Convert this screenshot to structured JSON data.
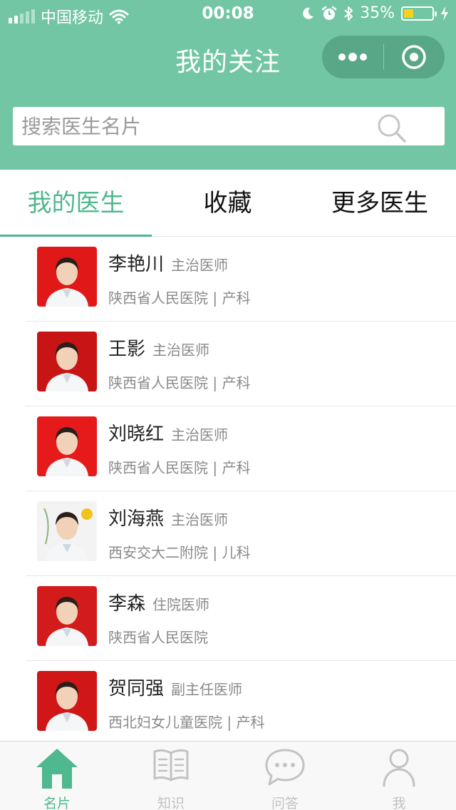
{
  "status_bar": {
    "carrier": "中国移动",
    "time": "00:08",
    "battery": "35%",
    "battery_level": 0.35
  },
  "nav": {
    "title": "我的关注",
    "more_icon": "more-dots-icon",
    "close_icon": "target-circle-icon"
  },
  "search": {
    "placeholder": "搜索医生名片",
    "icon": "search-icon"
  },
  "tabs": [
    {
      "label": "我的医生",
      "active": true
    },
    {
      "label": "收藏",
      "active": false
    },
    {
      "label": "更多医生",
      "active": false
    }
  ],
  "doctors": [
    {
      "name": "李艳川",
      "title": "主治医师",
      "hospital": "陕西省人民医院 | 产科",
      "photo_bg": "#e01818"
    },
    {
      "name": "王影",
      "title": "主治医师",
      "hospital": "陕西省人民医院 | 产科",
      "photo_bg": "#c81414"
    },
    {
      "name": "刘晓红",
      "title": "主治医师",
      "hospital": "陕西省人民医院 | 产科",
      "photo_bg": "#e61a1a"
    },
    {
      "name": "刘海燕",
      "title": "主治医师",
      "hospital": "西安交大二附院 | 儿科",
      "photo_bg": "#f3f3f3"
    },
    {
      "name": "李森",
      "title": "住院医师",
      "hospital": "陕西省人民医院",
      "photo_bg": "#d21c1c"
    },
    {
      "name": "贺同强",
      "title": "副主任医师",
      "hospital": "西北妇女儿童医院 | 产科",
      "photo_bg": "#d01616"
    }
  ],
  "tabbar": [
    {
      "label": "名片",
      "icon": "home-icon",
      "active": true
    },
    {
      "label": "知识",
      "icon": "book-icon",
      "active": false
    },
    {
      "label": "问答",
      "icon": "chat-bubble-icon",
      "active": false
    },
    {
      "label": "我",
      "icon": "person-icon",
      "active": false
    }
  ],
  "colors": {
    "primary": "#72c6a4",
    "accent": "#4fb88e",
    "inactive": "#c2c2c2"
  }
}
